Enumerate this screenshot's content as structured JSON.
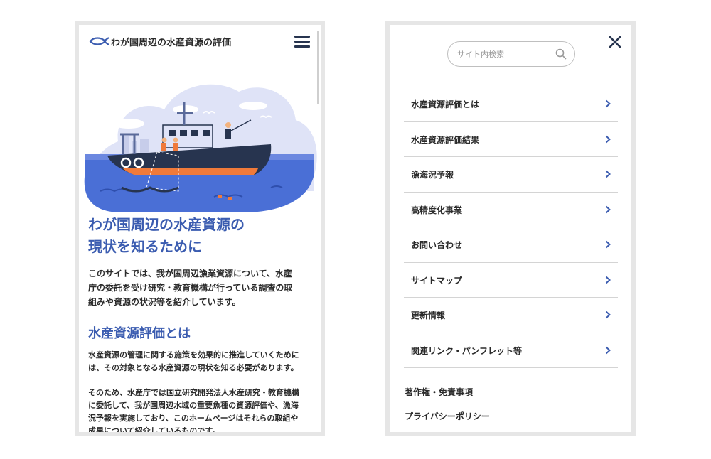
{
  "site": {
    "title": "わが国周辺の水産資源の評価"
  },
  "hero": {
    "heading_line1": "わが国周辺の水産資源の",
    "heading_line2": "現状を知るために"
  },
  "intro": {
    "lines": [
      "このサイトでは、我が国周辺漁業資源について、水産",
      "庁の委託を受け研究・教育機構が行っている調査の取",
      "組みや資源の状況等を紹介しています。"
    ]
  },
  "section": {
    "heading": "水産資源評価とは",
    "para1": [
      "水産資源の管理に関する施策を効果的に推進していくために",
      "は、その対象となる水産資源の現状を知る必要があります。"
    ],
    "para2": [
      "そのため、水産庁では国立研究開発法人水産研究・教育機構",
      "に委託して、我が国周辺水域の重要魚種の資源評価や、漁海",
      "況予報を実施しており、このホームページはそれらの取組や",
      "成果について紹介しているものです。"
    ]
  },
  "menu": {
    "search_placeholder": "サイト内検索",
    "items": [
      "水産資源評価とは",
      "水産資源評価結果",
      "漁海況予報",
      "高精度化事業",
      "お問い合わせ",
      "サイトマップ",
      "更新情報",
      "関連リンク・パンフレット等"
    ],
    "footer": {
      "copyright": "著作権・免責事項",
      "privacy": "プライバシーポリシー"
    }
  },
  "icons": {
    "logo": "fish-icon",
    "menu": "hamburger-icon",
    "close": "close-icon",
    "search": "search-icon",
    "chevron": "chevron-right-icon"
  },
  "colors": {
    "accent": "#3b5cb0",
    "navy": "#27344f",
    "frame": "#e6e6e6"
  }
}
